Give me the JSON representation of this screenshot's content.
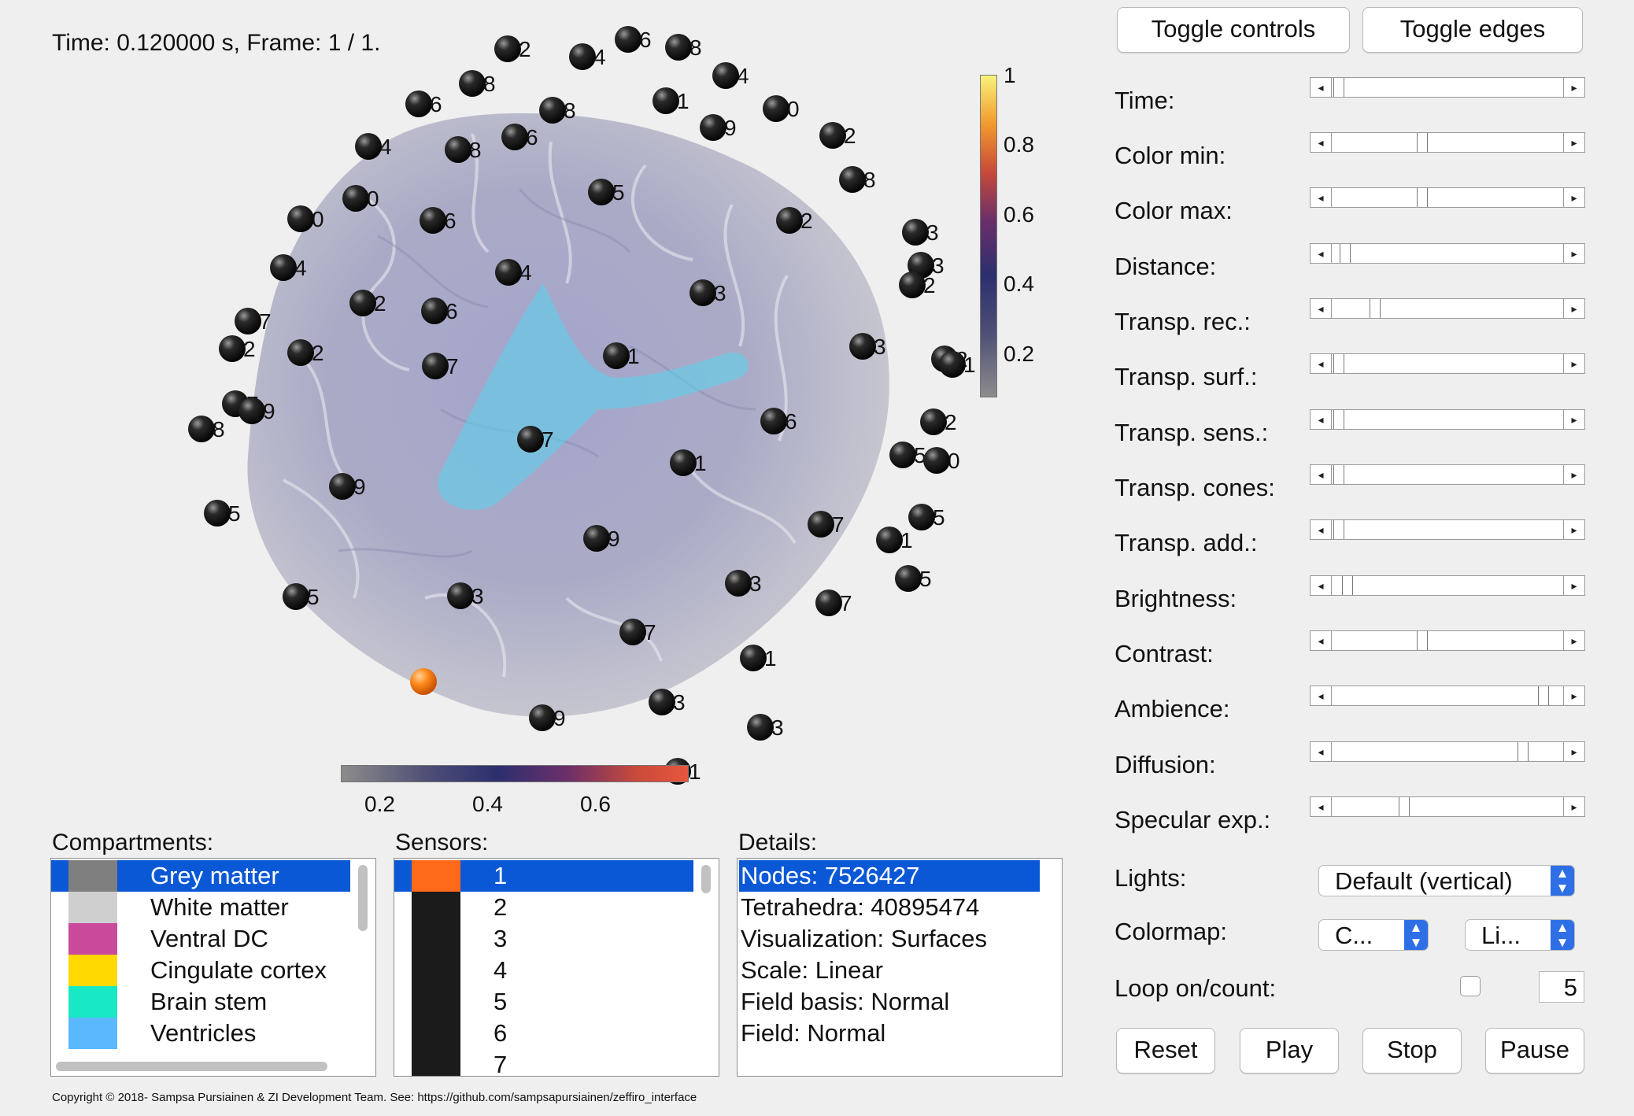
{
  "viewport": {
    "time_text": "Time: 0.120000 s, Frame: 1 / 1.",
    "vertical_colorbar_ticks": [
      "1",
      "0.8",
      "0.6",
      "0.4",
      "0.2"
    ],
    "horizontal_colorbar_ticks": [
      "0.2",
      "0.4",
      "0.6"
    ],
    "sensor_labels": [
      "2",
      "4",
      "6",
      "8",
      "4",
      "8",
      "6",
      "8",
      "1",
      "9",
      "0",
      "4",
      "8",
      "6",
      "2",
      "0",
      "8",
      "5",
      "0",
      "6",
      "2",
      "4",
      "3",
      "4",
      "3",
      "2",
      "2",
      "3",
      "7",
      "6",
      "3",
      "2",
      "2",
      "2",
      "7",
      "1",
      "1",
      "7",
      "9",
      "8",
      "6",
      "2",
      "1",
      "7",
      "5",
      "0",
      "9",
      "5",
      "7",
      "5",
      "9",
      "1",
      "5",
      "3",
      "5",
      "3",
      "7",
      "7",
      "1",
      "9",
      "3",
      "3",
      "1",
      "4",
      "1"
    ]
  },
  "header_buttons": {
    "toggle_controls": "Toggle controls",
    "toggle_edges": "Toggle edges"
  },
  "sliders": [
    {
      "label": "Time:",
      "value": 0.01
    },
    {
      "label": "Color min:",
      "value": 0.38
    },
    {
      "label": "Color max:",
      "value": 0.38
    },
    {
      "label": "Distance:",
      "value": 0.04
    },
    {
      "label": "Transp. rec.:",
      "value": 0.17
    },
    {
      "label": "Transp. surf.:",
      "value": 0.01
    },
    {
      "label": "Transp. sens.:",
      "value": 0.01
    },
    {
      "label": "Transp. cones:",
      "value": 0.01
    },
    {
      "label": "Transp. add.:",
      "value": 0.01
    },
    {
      "label": "Brightness:",
      "value": 0.05
    },
    {
      "label": "Contrast:",
      "value": 0.38
    },
    {
      "label": "Ambience:",
      "value": 0.92
    },
    {
      "label": "Diffusion:",
      "value": 0.83
    },
    {
      "label": "Specular exp.:",
      "value": 0.3
    }
  ],
  "lights": {
    "label": "Lights:",
    "value": "Default (vertical)"
  },
  "colormap": {
    "label": "Colormap:",
    "value1": "C...",
    "value2": "Li..."
  },
  "loop": {
    "label": "Loop on/count:",
    "count": "5",
    "checked": false
  },
  "playback": {
    "reset": "Reset",
    "play": "Play",
    "stop": "Stop",
    "pause": "Pause"
  },
  "compartments": {
    "title": "Compartments:",
    "items": [
      {
        "name": "Grey matter",
        "color": "#7f7f7f"
      },
      {
        "name": "White matter",
        "color": "#cfcfcf"
      },
      {
        "name": "Ventral DC",
        "color": "#c94a9b"
      },
      {
        "name": "Cingulate cortex",
        "color": "#ffd900"
      },
      {
        "name": "Brain stem",
        "color": "#19e8c4"
      },
      {
        "name": "Ventricles",
        "color": "#5ab8ff"
      }
    ]
  },
  "sensors": {
    "title": "Sensors:",
    "items": [
      "1",
      "2",
      "3",
      "4",
      "5",
      "6",
      "7"
    ],
    "selected_color": "#ff6a1a",
    "color": "#1b1b1b"
  },
  "details": {
    "title": "Details:",
    "items": [
      "Nodes: 7526427",
      "Tetrahedra: 40895474",
      "Visualization: Surfaces",
      "Scale: Linear",
      "Field basis: Normal",
      "Field: Normal"
    ]
  },
  "copyright": "Copyright © 2018- Sampsa Pursiainen & ZI Development Team. See: https://github.com/sampsapursiainen/zeffiro_interface"
}
